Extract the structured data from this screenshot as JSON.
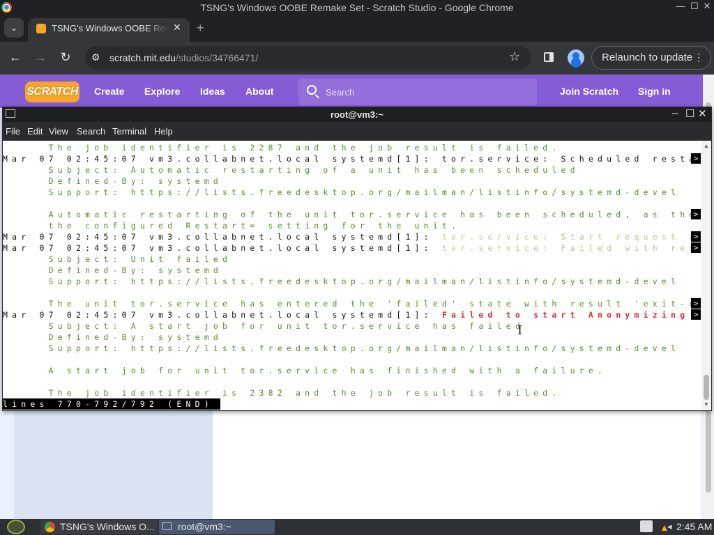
{
  "chrome": {
    "window_title": "TSNG's Windows OOBE Remake Set - Scratch Studio - Google Chrome",
    "tab_title": "TSNG's Windows OOBE Remake Set",
    "url_host": "scratch.mit.edu",
    "url_path": "/studios/34766471/",
    "relaunch_label": "Relaunch to update"
  },
  "scratch": {
    "logo_text": "SCRATCH",
    "nav": [
      "Create",
      "Explore",
      "Ideas",
      "About"
    ],
    "search_placeholder": "Search",
    "join_label": "Join Scratch",
    "signin_label": "Sign in"
  },
  "terminal": {
    "title": "root@vm3:~",
    "menu": [
      "File",
      "Edit",
      "View",
      "Search",
      "Terminal",
      "Help"
    ],
    "lines": [
      {
        "segs": [
          {
            "c": "g",
            "t": "     The job identifier is 2287 and the job result is failed."
          }
        ]
      },
      {
        "segs": [
          {
            "c": "k",
            "t": "Mar 07 02:45:07 vm3.collabnet.local systemd[1]: tor.service: Scheduled resta"
          }
        ],
        "more": true
      },
      {
        "segs": [
          {
            "c": "g",
            "t": "     Subject: Automatic restarting of a unit has been scheduled"
          }
        ]
      },
      {
        "segs": [
          {
            "c": "g",
            "t": "     Defined-By: systemd"
          }
        ]
      },
      {
        "segs": [
          {
            "c": "g",
            "t": "     Support: https://lists.freedesktop.org/mailman/listinfo/systemd-devel"
          }
        ]
      },
      {
        "segs": [
          {
            "c": "g",
            "t": ""
          }
        ]
      },
      {
        "segs": [
          {
            "c": "g",
            "t": "     Automatic restarting of the unit tor.service has been scheduled, as the r"
          }
        ],
        "more": true
      },
      {
        "segs": [
          {
            "c": "g",
            "t": "     the configured Restart= setting for the unit."
          }
        ]
      },
      {
        "segs": [
          {
            "c": "k",
            "t": "Mar 07 02:45:07 vm3.collabnet.local systemd[1]: "
          },
          {
            "c": "y",
            "t": "tor.service: Start request r"
          }
        ],
        "more": true
      },
      {
        "segs": [
          {
            "c": "k",
            "t": "Mar 07 02:45:07 vm3.collabnet.local systemd[1]: "
          },
          {
            "c": "y",
            "t": "tor.service: Failed with res"
          }
        ],
        "more": true
      },
      {
        "segs": [
          {
            "c": "g",
            "t": "     Subject: Unit failed"
          }
        ]
      },
      {
        "segs": [
          {
            "c": "g",
            "t": "     Defined-By: systemd"
          }
        ]
      },
      {
        "segs": [
          {
            "c": "g",
            "t": "     Support: https://lists.freedesktop.org/mailman/listinfo/systemd-devel"
          }
        ]
      },
      {
        "segs": [
          {
            "c": "g",
            "t": ""
          }
        ]
      },
      {
        "segs": [
          {
            "c": "g",
            "t": "     The unit tor.service has entered the 'failed' state with result 'exit-cod"
          }
        ],
        "more": true
      },
      {
        "segs": [
          {
            "c": "k",
            "t": "Mar 07 02:45:07 vm3.collabnet.local systemd[1]: "
          },
          {
            "c": "r",
            "t": "Failed to start Anonymizing"
          }
        ],
        "more": true
      },
      {
        "segs": [
          {
            "c": "g",
            "t": "     Subject: A start job for unit tor.service has failed"
          }
        ]
      },
      {
        "segs": [
          {
            "c": "g",
            "t": "     Defined-By: systemd"
          }
        ]
      },
      {
        "segs": [
          {
            "c": "g",
            "t": "     Support: https://lists.freedesktop.org/mailman/listinfo/systemd-devel"
          }
        ]
      },
      {
        "segs": [
          {
            "c": "g",
            "t": ""
          }
        ]
      },
      {
        "segs": [
          {
            "c": "g",
            "t": "     A start job for unit tor.service has finished with a failure."
          }
        ]
      },
      {
        "segs": [
          {
            "c": "g",
            "t": ""
          }
        ]
      },
      {
        "segs": [
          {
            "c": "g",
            "t": "     The job identifier is 2382 and the job result is failed."
          }
        ]
      }
    ],
    "more_marker": ">",
    "status_line": "lines 770-792/792 (END)"
  },
  "taskbar": {
    "chrome_label": "TSNG's Windows O...",
    "terminal_label": "root@vm3:~",
    "clock": "2:45 AM"
  }
}
